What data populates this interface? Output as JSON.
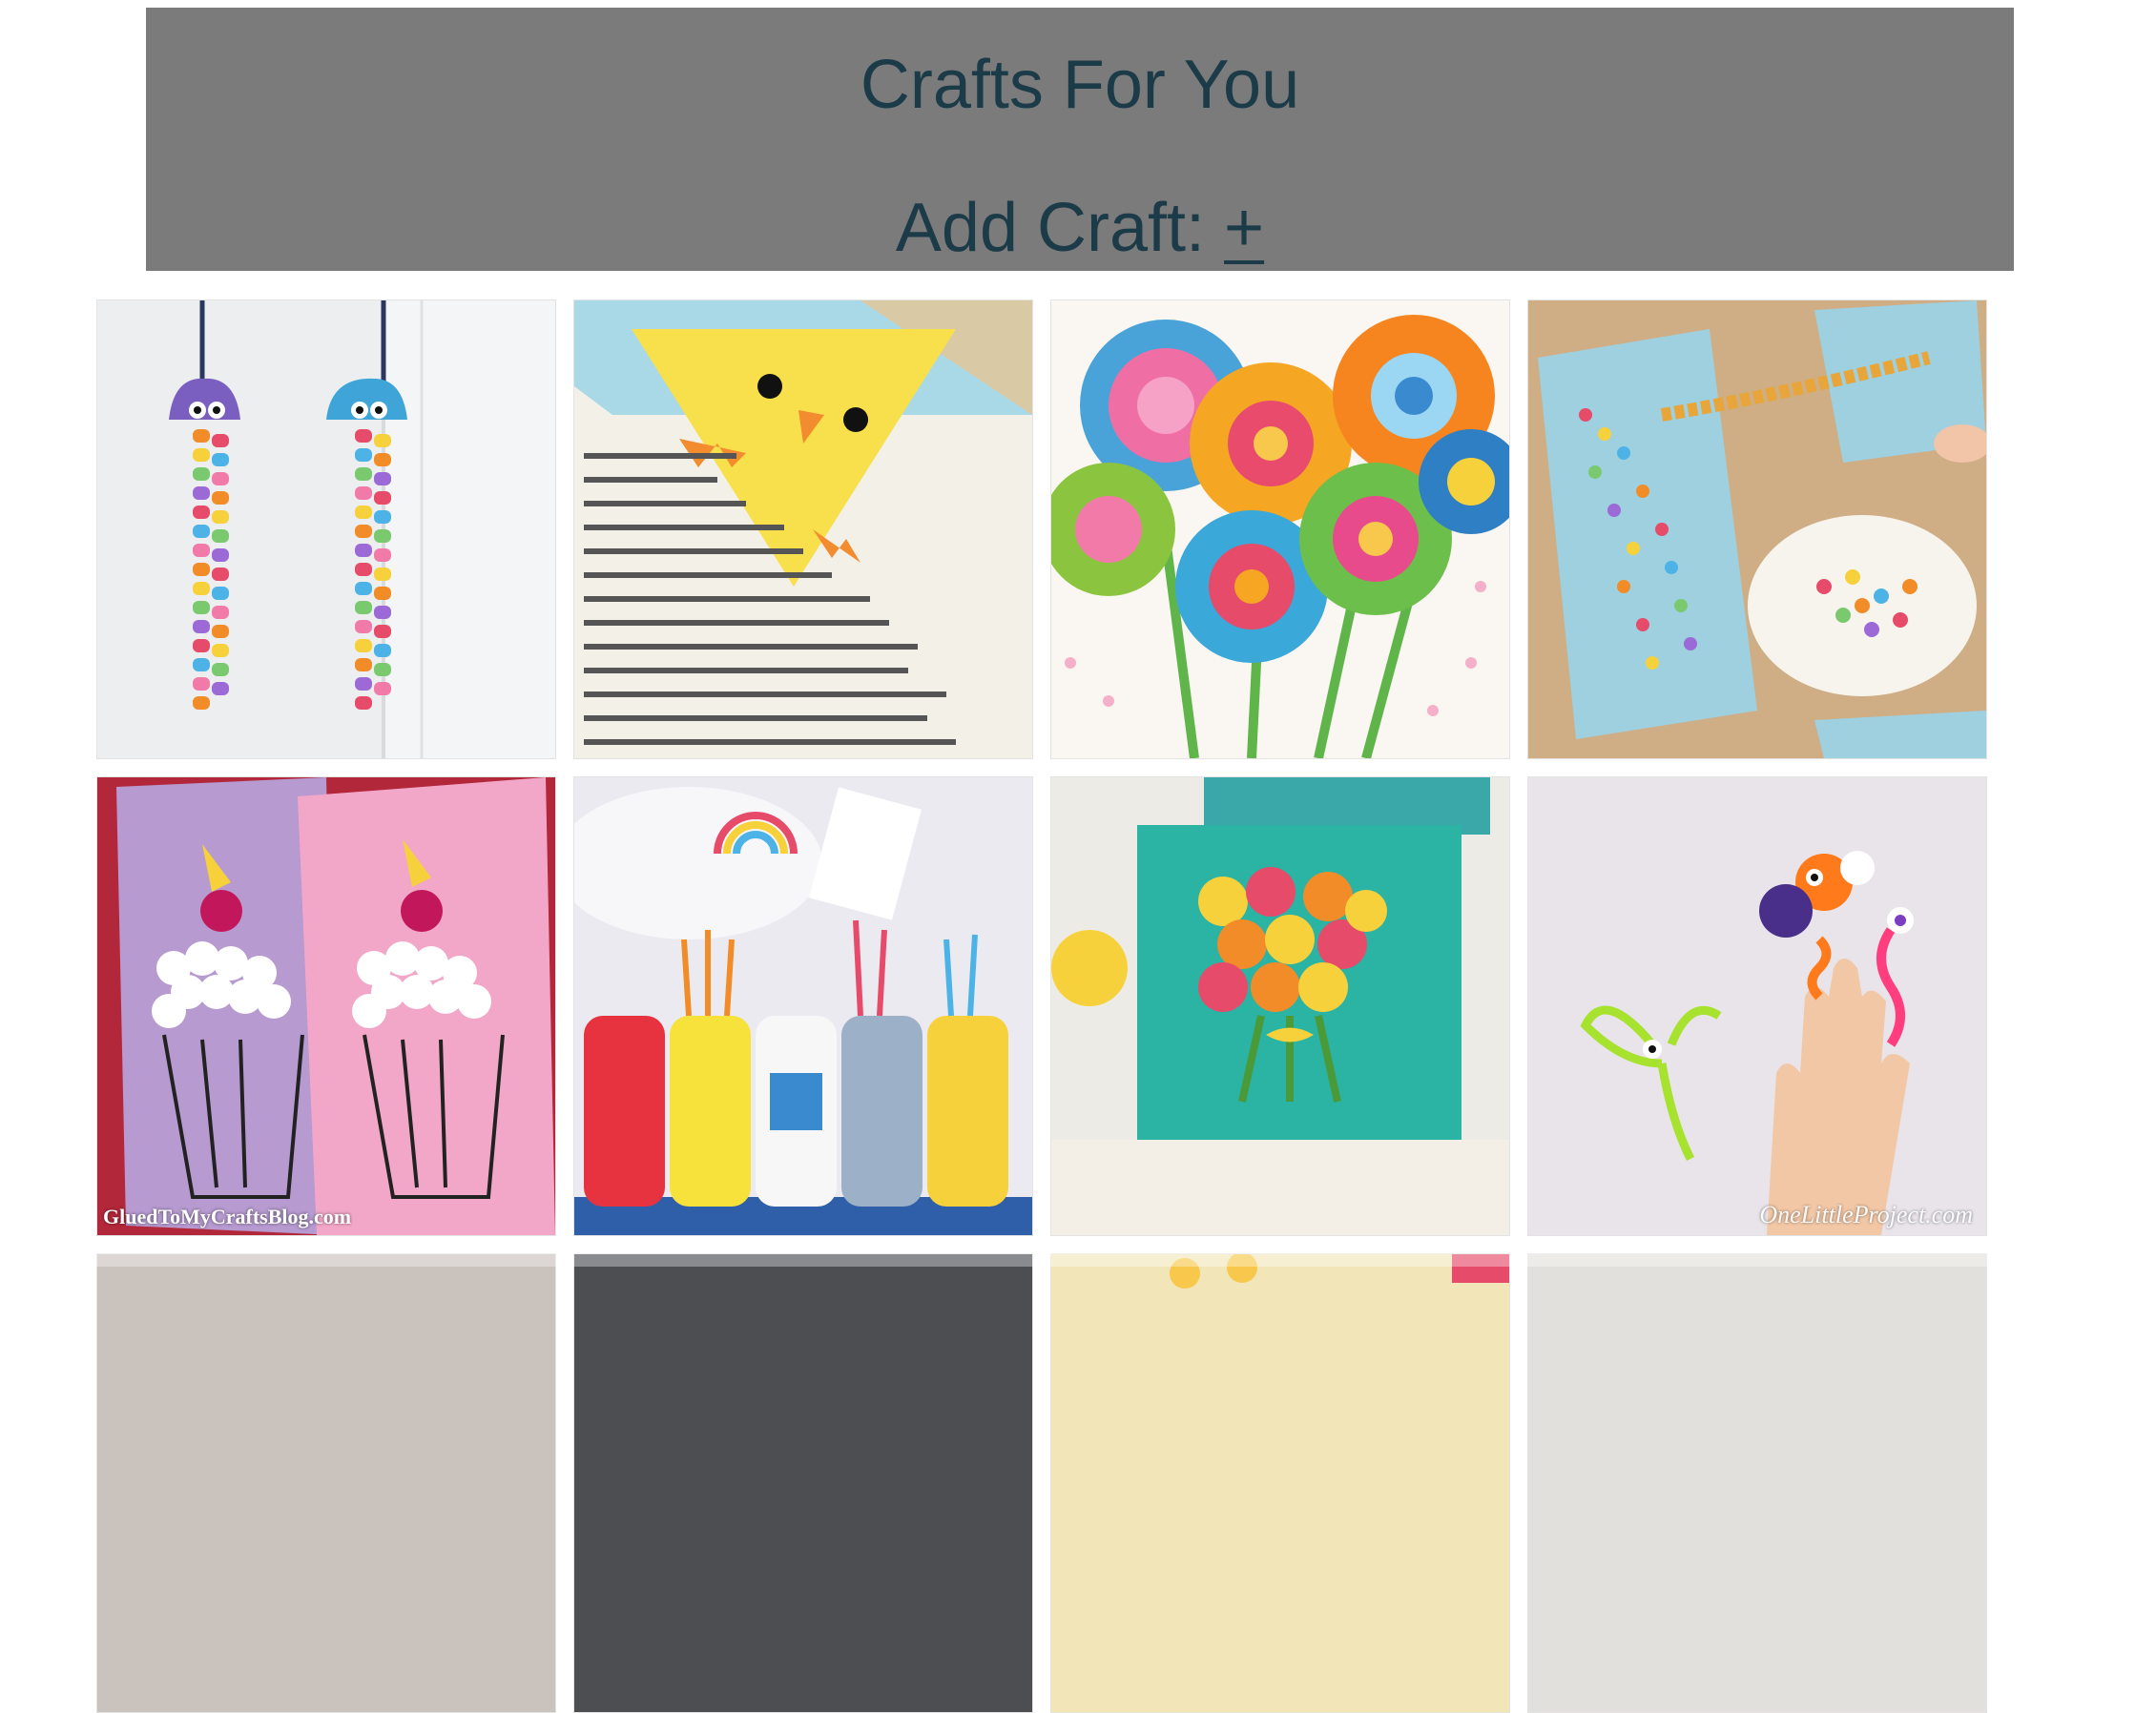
{
  "header": {
    "title": "Crafts For You",
    "add_label": "Add Craft: ",
    "add_symbol": "+"
  },
  "colors": {
    "header_bg": "#7b7b7b",
    "header_text": "#1c3b48"
  },
  "crafts": [
    {
      "caption": ""
    },
    {
      "caption": ""
    },
    {
      "caption": ""
    },
    {
      "caption": ""
    },
    {
      "caption": "GluedToMyCraftsBlog.com"
    },
    {
      "caption": ""
    },
    {
      "caption": ""
    },
    {
      "caption": "OneLittleProject.com"
    }
  ]
}
